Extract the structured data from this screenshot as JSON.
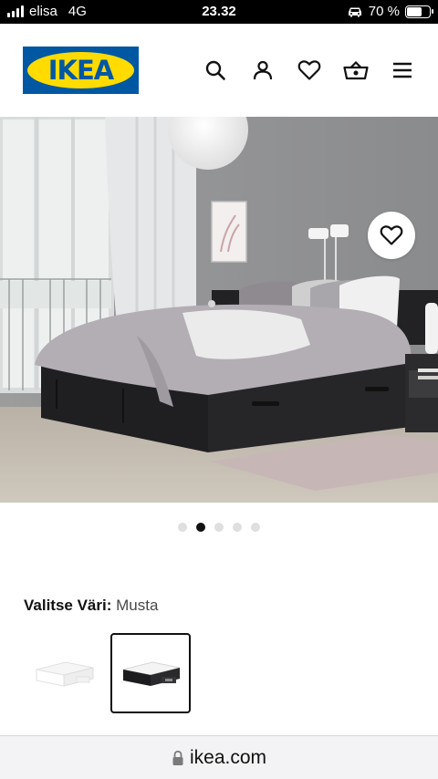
{
  "status_bar": {
    "carrier": "elisa",
    "network": "4G",
    "time": "23.32",
    "battery": "70 %",
    "battery_level": 0.7,
    "car_icon": "car-icon",
    "battery_icon": "battery-icon"
  },
  "header": {
    "logo_text": "IKEA",
    "icons": [
      "search-icon",
      "profile-icon",
      "heart-icon",
      "basket-icon",
      "menu-icon"
    ],
    "brand_blue": "#0058a3",
    "brand_yellow": "#ffdb00"
  },
  "hero": {
    "favourite_icon": "heart-icon"
  },
  "carousel": {
    "dot_count": 5,
    "active_index": 1
  },
  "color_selector": {
    "label": "Valitse Väri:",
    "value": "Musta",
    "options": [
      "white-bed",
      "black-bed"
    ],
    "selected_index": 1
  },
  "browser": {
    "url": "ikea.com",
    "lock_icon": "lock-icon"
  }
}
